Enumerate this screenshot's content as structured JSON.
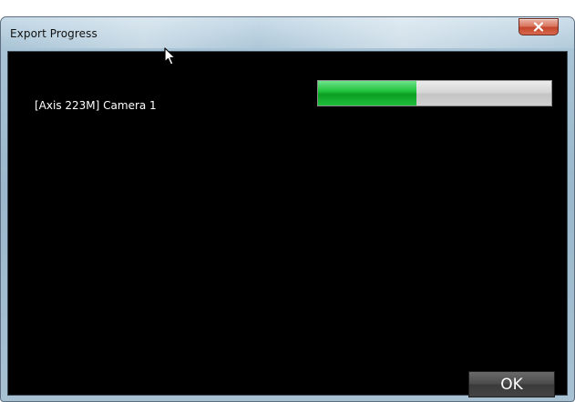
{
  "window": {
    "title": "Export Progress"
  },
  "jobs": [
    {
      "label": "[Axis 223M] Camera 1",
      "progress_fraction": 0.42
    }
  ],
  "buttons": {
    "ok_label": "OK"
  },
  "icons": {
    "close": "close-icon",
    "cursor": "mouse-pointer-icon"
  },
  "colors": {
    "content_background": "#000000",
    "progress_fill": "#22c43f",
    "progress_track": "#d0d0d0",
    "close_button": "#c4462b"
  }
}
